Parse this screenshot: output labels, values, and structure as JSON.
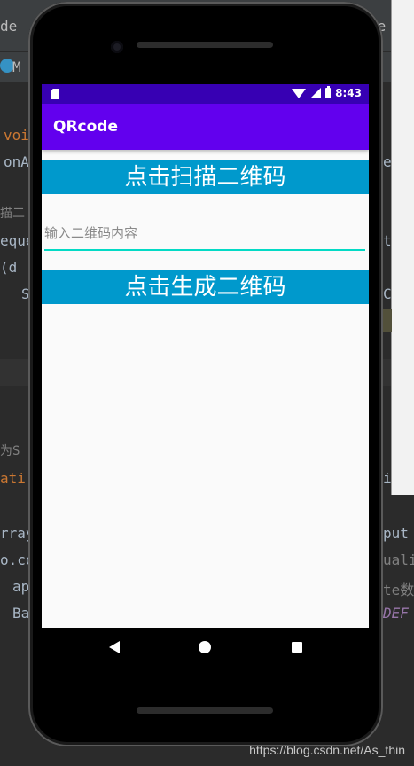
{
  "ide": {
    "fragments": [
      "de",
      "M",
      "voi",
      "onA",
      "描二",
      "eque",
      "(d",
      "S",
      "为S",
      "ati",
      "rray",
      "o.co",
      "ap",
      "Ba",
      "re",
      "e",
      "t",
      "C",
      "put",
      "uali",
      "te数",
      "DEF",
      "i"
    ]
  },
  "status_bar": {
    "time": "8:43"
  },
  "app_bar": {
    "title": "QRcode"
  },
  "main": {
    "scan_button_label": "点击扫描二维码",
    "input_placeholder": "输入二维码内容",
    "input_value": "",
    "generate_button_label": "点击生成二维码"
  },
  "watermark": "https://blog.csdn.net/As_thin",
  "colors": {
    "status_bar": "#3700b3",
    "app_bar": "#6200ee",
    "button": "#0099cc",
    "input_underline": "#03dac5"
  }
}
